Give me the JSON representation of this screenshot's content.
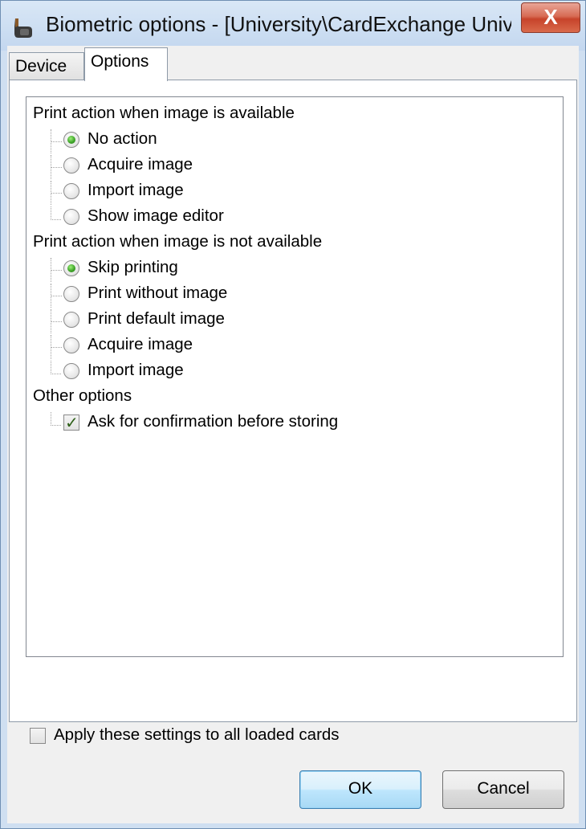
{
  "window": {
    "title": "Biometric options - [University\\CardExchange Univers...",
    "close_glyph": "X"
  },
  "tabs": [
    {
      "label": "Device",
      "active": false
    },
    {
      "label": "Options",
      "active": true
    }
  ],
  "groups": [
    {
      "title": "Print action when image is available",
      "options": [
        {
          "label": "No action",
          "checked": true
        },
        {
          "label": "Acquire image",
          "checked": false
        },
        {
          "label": "Import image",
          "checked": false
        },
        {
          "label": "Show image editor",
          "checked": false
        }
      ]
    },
    {
      "title": "Print action when image is not available",
      "options": [
        {
          "label": "Skip printing",
          "checked": true
        },
        {
          "label": "Print without image",
          "checked": false
        },
        {
          "label": "Print default image",
          "checked": false
        },
        {
          "label": "Acquire image",
          "checked": false
        },
        {
          "label": "Import image",
          "checked": false
        }
      ]
    },
    {
      "title": "Other options",
      "options": [
        {
          "label": "Ask for confirmation before storing",
          "checked": true
        }
      ]
    }
  ],
  "apply_all": {
    "label": "Apply these settings to all loaded cards",
    "checked": false
  },
  "buttons": {
    "ok": "OK",
    "cancel": "Cancel"
  },
  "colors": {
    "radio_checked": "#3fa52a",
    "close_button": "#c7432a",
    "ok_border": "#3c7fb1"
  }
}
